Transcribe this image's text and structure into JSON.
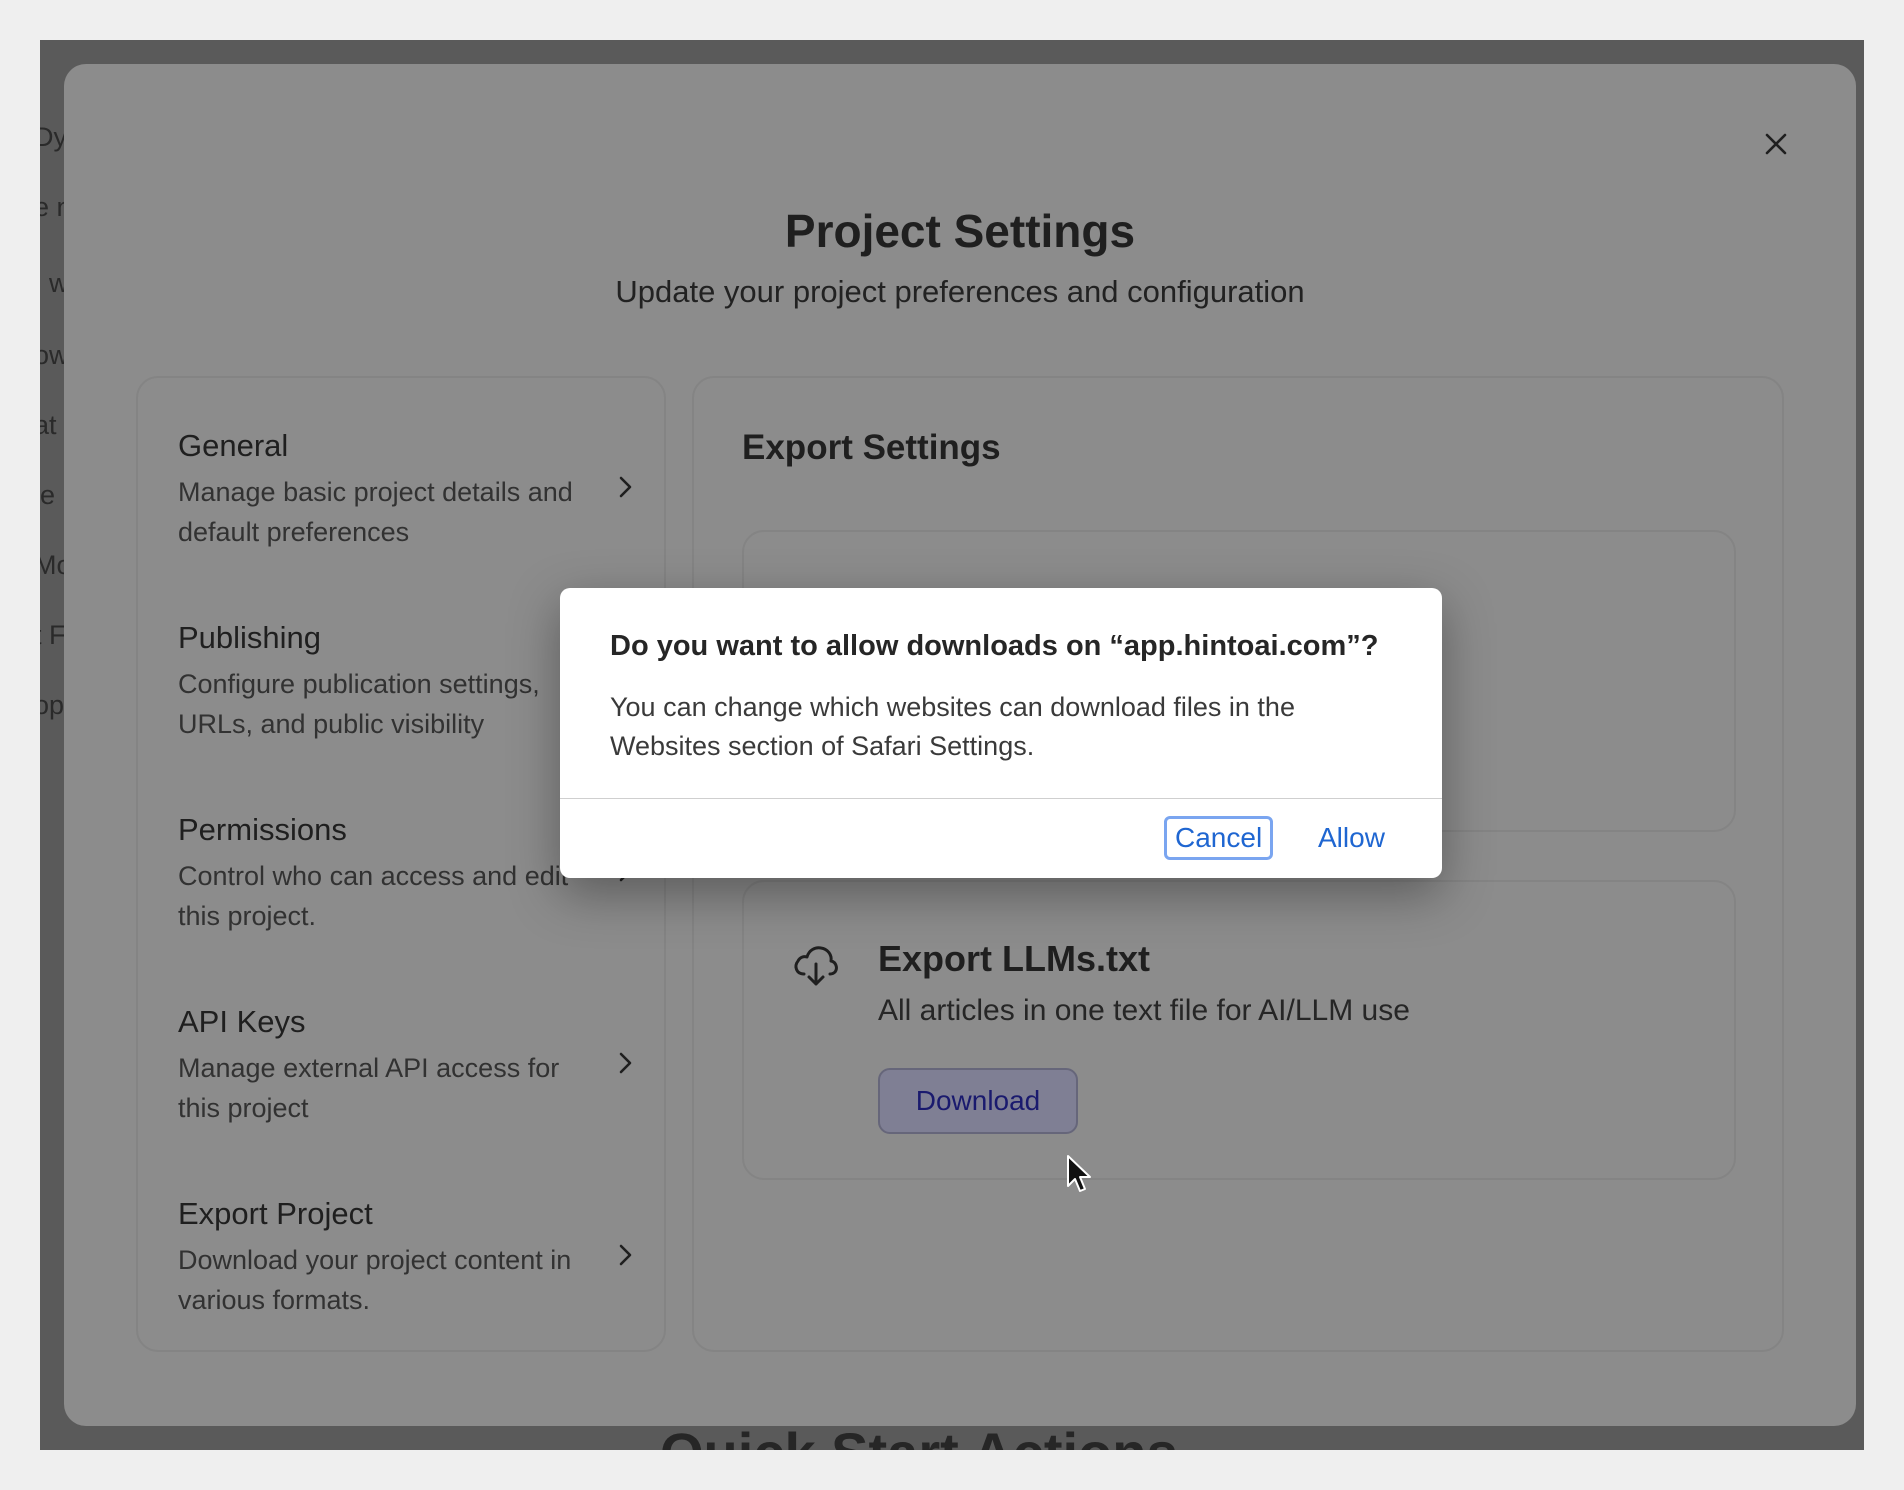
{
  "modal": {
    "title": "Project Settings",
    "subtitle": "Update your project preferences and configuration",
    "close_icon": "close-icon"
  },
  "nav": {
    "items": [
      {
        "title": "General",
        "desc": "Manage basic project details and default preferences"
      },
      {
        "title": "Publishing",
        "desc": "Configure publication settings, URLs, and public visibility"
      },
      {
        "title": "Permissions",
        "desc": "Control who can access and edit this project."
      },
      {
        "title": "API Keys",
        "desc": "Manage external API access for this project"
      },
      {
        "title": "Export Project",
        "desc": "Download your project content in various formats."
      }
    ]
  },
  "export": {
    "title": "Export Settings",
    "llms_card": {
      "icon": "cloud-download-icon",
      "title": "Export LLMs.txt",
      "desc": "All articles in one text file for AI/LLM use",
      "button": "Download"
    }
  },
  "dialog": {
    "title": "Do you want to allow downloads on “app.hintoai.com”?",
    "message": "You can change which websites can download files in the Websites section of Safari Settings.",
    "cancel": "Cancel",
    "allow": "Allow"
  },
  "background": {
    "heading_fragment": "Quick Start Actions",
    "left_fragments": [
      "Dy",
      "e n",
      ": w",
      "ow",
      "at",
      "le",
      "Mo",
      "t F",
      "op"
    ]
  },
  "colors": {
    "dialog_button": "#1f66d1",
    "overlay": "#8c8c8c"
  }
}
